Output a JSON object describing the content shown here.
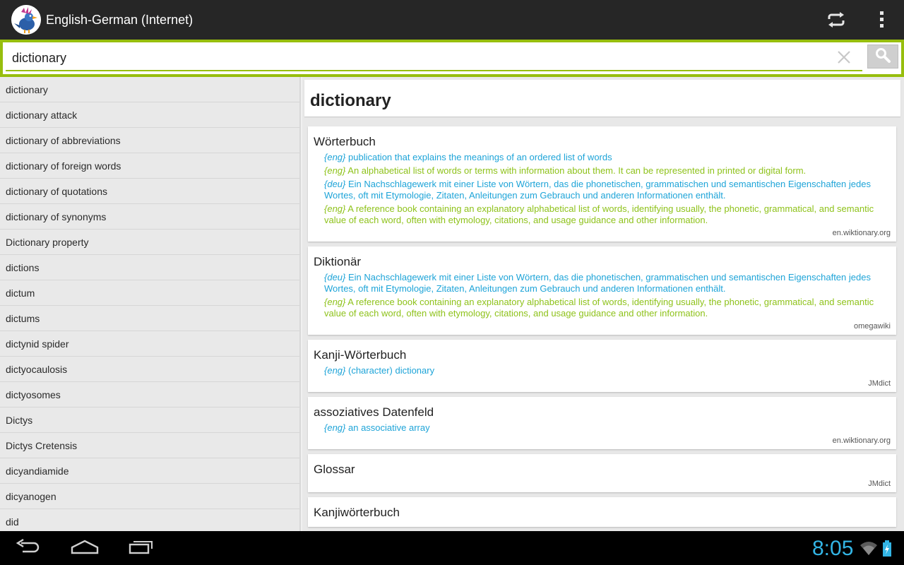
{
  "app": {
    "title": "English-German (Internet)",
    "logo_icon": "app-logo-bird-icon",
    "actions": [
      {
        "name": "swap-languages-icon"
      },
      {
        "name": "overflow-menu-icon"
      }
    ]
  },
  "search": {
    "value": "dictionary",
    "clear_icon": "close-icon",
    "search_icon": "search-icon"
  },
  "word_list": [
    "dictionary",
    "dictionary attack",
    "dictionary of abbreviations",
    "dictionary of foreign words",
    "dictionary of quotations",
    "dictionary of synonyms",
    "Dictionary property",
    "dictions",
    "dictum",
    "dictums",
    "dictynid spider",
    "dictyocaulosis",
    "dictyosomes",
    "Dictys",
    "Dictys Cretensis",
    "dicyandiamide",
    "dicyanogen",
    "did"
  ],
  "detail": {
    "headword": "dictionary",
    "cards": [
      {
        "title": "Wörterbuch",
        "defs": [
          {
            "lang": "{eng}",
            "text": "publication that explains the meanings of an ordered list of words",
            "color": "blue"
          },
          {
            "lang": "{eng}",
            "text": "An alphabetical list of words or terms with information about them. It can be represented in printed or digital form.",
            "color": "green"
          },
          {
            "lang": "{deu}",
            "text": "Ein Nachschlagewerk mit einer Liste von Wörtern, das die phonetischen, grammatischen und semantischen Eigenschaften jedes Wortes, oft mit Etymologie, Zitaten, Anleitungen zum Gebrauch und anderen Informationen enthält.",
            "color": "blue"
          },
          {
            "lang": "{eng}",
            "text": "A reference book containing an explanatory alphabetical list of words, identifying usually, the phonetic, grammatical, and semantic value of each word, often with etymology, citations, and usage guidance and other information.",
            "color": "green"
          }
        ],
        "source": "en.wiktionary.org"
      },
      {
        "title": "Diktionär",
        "defs": [
          {
            "lang": "{deu}",
            "text": "Ein Nachschlagewerk mit einer Liste von Wörtern, das die phonetischen, grammatischen und semantischen Eigenschaften jedes Wortes, oft mit Etymologie, Zitaten, Anleitungen zum Gebrauch und anderen Informationen enthält.",
            "color": "blue"
          },
          {
            "lang": "{eng}",
            "text": "A reference book containing an explanatory alphabetical list of words, identifying usually, the phonetic, grammatical, and semantic value of each word, often with etymology, citations, and usage guidance and other information.",
            "color": "green"
          }
        ],
        "source": "omegawiki"
      },
      {
        "title": "Kanji-Wörterbuch",
        "defs": [
          {
            "lang": "{eng}",
            "text": "(character) dictionary",
            "color": "blue"
          }
        ],
        "source": "JMdict"
      },
      {
        "title": "assoziatives Datenfeld",
        "defs": [
          {
            "lang": "{eng}",
            "text": "an associative array",
            "color": "blue"
          }
        ],
        "source": "en.wiktionary.org"
      },
      {
        "title": "Glossar",
        "defs": [],
        "source": "JMdict"
      },
      {
        "title": "Kanjiwörterbuch",
        "defs": [],
        "source": ""
      }
    ]
  },
  "colors": {
    "accent": "#97be0d",
    "def_blue": "#1ea4d8",
    "def_green": "#8ec21a",
    "clock": "#33b5e5"
  },
  "navbar": {
    "buttons": [
      "back-icon",
      "home-icon",
      "recent-apps-icon"
    ],
    "clock": "8:05",
    "status_icons": [
      "wifi-icon",
      "battery-charging-icon"
    ]
  }
}
